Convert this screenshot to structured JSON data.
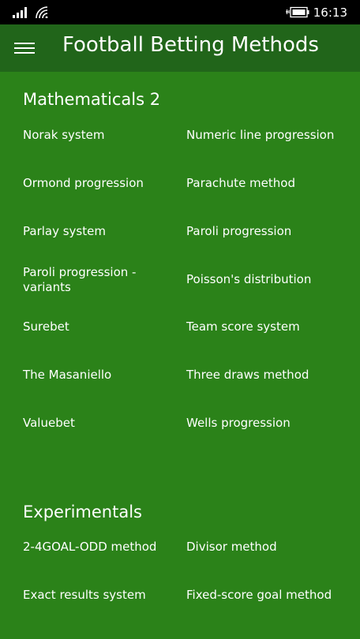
{
  "status_bar": {
    "time": "16:13",
    "icons": [
      "signal-icon",
      "wifi-icon",
      "battery-charging-icon"
    ]
  },
  "app_bar": {
    "menu_icon": "hamburger-menu-icon",
    "title": "Football Betting Methods"
  },
  "colors": {
    "background": "#2b8219",
    "app_bar": "#21651a",
    "status_bar": "#000000",
    "text": "#ffffff"
  },
  "sections": [
    {
      "title": "Mathematicals 2",
      "items": [
        "Norak system",
        "Numeric line progression",
        "Ormond progression",
        "Parachute method",
        "Parlay system",
        "Paroli progression",
        "Paroli progression - variants",
        "Poisson's distribution",
        "Surebet",
        "Team score system",
        "The Masaniello",
        "Three draws method",
        "Valuebet",
        "Wells progression"
      ]
    },
    {
      "title": "Experimentals",
      "items": [
        "2-4GOAL-ODD method",
        "Divisor method",
        "Exact results system",
        "Fixed-score goal method"
      ]
    }
  ]
}
